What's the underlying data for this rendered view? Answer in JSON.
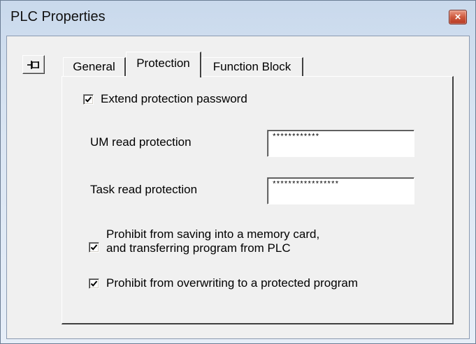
{
  "window": {
    "title": "PLC Properties",
    "close_glyph": "×",
    "accent_colors": {
      "close": "#c8492f",
      "frame": "#c9d9ec"
    }
  },
  "toolbar": {
    "pin_icon": "pushpin-icon"
  },
  "tabs": [
    {
      "label": "General",
      "active": false
    },
    {
      "label": "Protection",
      "active": true
    },
    {
      "label": "Function Block",
      "active": false
    }
  ],
  "protection": {
    "extend_password": {
      "label": "Extend protection password",
      "checked": true
    },
    "um_read": {
      "label": "UM read protection",
      "value": "************"
    },
    "task_read": {
      "label": "Task read protection",
      "value": "*****************"
    },
    "prohibit_saving": {
      "line1": "Prohibit from saving into a memory card,",
      "line2": "and transferring program from PLC",
      "checked": true
    },
    "prohibit_overwrite": {
      "label": "Prohibit from overwriting to a protected program",
      "checked": true
    }
  }
}
